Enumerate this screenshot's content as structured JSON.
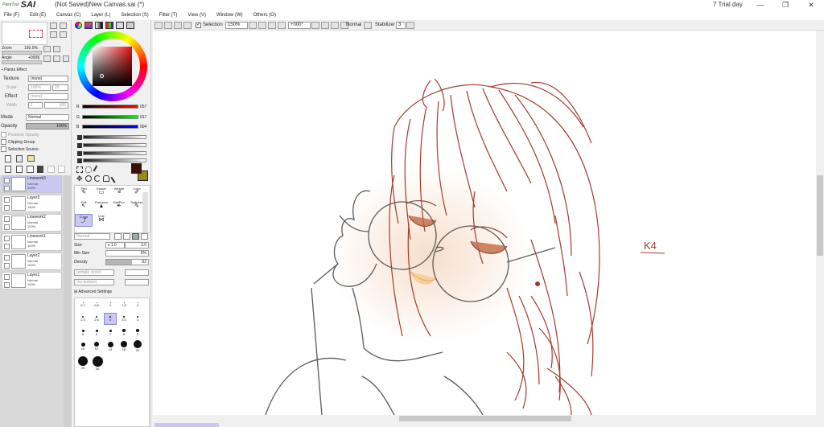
{
  "window": {
    "app_logo_top": "PaintTool",
    "app_logo_name": "SAI",
    "title": "(Not Saved)New Canvas.sai (*)",
    "trial": "7 Trial day",
    "minimize": "—",
    "maximize": "❐",
    "close": "✕"
  },
  "menu": [
    "File (F)",
    "Edit (E)",
    "Canvas (C)",
    "Layer (L)",
    "Selection (S)",
    "Filter (T)",
    "View (V)",
    "Window (W)",
    "Others (O)"
  ],
  "toolbar": {
    "selection_label": "Selection",
    "zoom_value": "150%",
    "rotation_value": "+000°",
    "mode_value": "Normal",
    "stabilizer_label": "Stabilizer",
    "stabilizer_value": "3"
  },
  "navigator": {
    "zoom_label": "Zoom",
    "zoom_value": "150.0%",
    "angle_label": "Angle",
    "angle_value": "+000$"
  },
  "paper_effect": {
    "header": "Paints Effect",
    "texture_label": "Texture",
    "texture_value": "(none)",
    "scale_label": "Scale",
    "scale_value": "100%",
    "strength_value": "20",
    "effect_label": "Effect",
    "effect_value": "(none)",
    "width_label": "Width",
    "width_value": "1",
    "effect_strength": "100"
  },
  "blend": {
    "mode_label": "Mode",
    "mode_value": "Normal",
    "opacity_label": "Opacity",
    "opacity_value": "100%",
    "preserve_opacity": "Preserve Opacity",
    "clipping_group": "Clipping Group",
    "selection_source": "Selection Source"
  },
  "layers": [
    {
      "name": "Linework3",
      "mode": "Normal",
      "opacity": "100%",
      "selected": true
    },
    {
      "name": "Layer3",
      "mode": "Normal",
      "opacity": "100%",
      "selected": false
    },
    {
      "name": "Linework2",
      "mode": "Normal",
      "opacity": "100%",
      "selected": false
    },
    {
      "name": "Linework1",
      "mode": "Normal",
      "opacity": "100%",
      "selected": false
    },
    {
      "name": "Layer2",
      "mode": "Normal",
      "opacity": "100%",
      "selected": false
    },
    {
      "name": "Layer1",
      "mode": "Normal",
      "opacity": "100%",
      "selected": false
    }
  ],
  "color": {
    "r_label": "R",
    "r_value": "057",
    "g_label": "G",
    "g_value": "017",
    "b_label": "B",
    "b_value": "004",
    "current_primary": "#391104",
    "current_secondary": "#9a8a1a"
  },
  "tools": {
    "row1": [
      "Pen",
      "Eraser",
      "Weight",
      "Color"
    ],
    "row2": [
      "Edit",
      "Pressure",
      "BallPen",
      "Softness"
    ],
    "row3": [
      "Curve",
      "Line"
    ]
  },
  "brush": {
    "mode_value": "Normal",
    "size_label": "Size",
    "size_mult": "x 1.0",
    "size_value": "3.0",
    "min_size_label": "Min Size",
    "min_size_value": "0%",
    "density_label": "Density",
    "density_value": "62",
    "shape_value": "(simple circle)",
    "texture_value": "(no texture)",
    "advanced": "Advanced Settings"
  },
  "brush_sizes": [
    [
      "0.7",
      "0.8",
      "1",
      "1.5",
      "2"
    ],
    [
      "2.3",
      "2.6",
      "3",
      "3.5",
      "4"
    ],
    [
      "5",
      "6",
      "7",
      "8",
      "9"
    ],
    [
      "10",
      "12",
      "14",
      "16",
      "20"
    ],
    [
      "25",
      "30"
    ]
  ],
  "canvas": {
    "signature": "K4"
  },
  "colors": {
    "line_red": "#a23a2c",
    "line_gray": "#5a5a5a",
    "accent_select": "#c9c8f3"
  }
}
